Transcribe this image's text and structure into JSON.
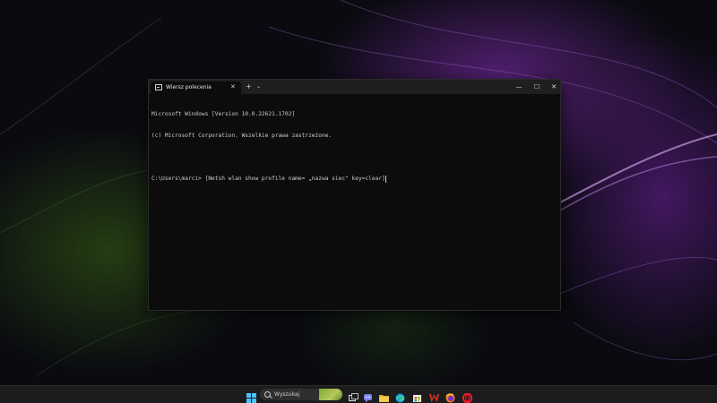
{
  "terminal": {
    "tab_title": "Wiersz polecenia",
    "tab_close": "✕",
    "new_tab": "+",
    "tab_dropdown": "⌄",
    "minimize": "—",
    "maximize": "☐",
    "close": "✕",
    "lines": [
      "Microsoft Windows [Version 10.0.22621.1702]",
      "(c) Microsoft Corporation. Wszelkie prawa zastrzeżone.",
      "",
      "C:\\Users\\marci> [Netsh wlan show profile name= „nazwa siec\" key=clear]"
    ]
  },
  "taskbar": {
    "search_placeholder": "Wyszukaj",
    "icons": [
      "windows-start-icon",
      "search-icon",
      "task-view-icon",
      "teams-chat-icon",
      "file-explorer-icon",
      "edge-icon",
      "store-icon",
      "office-w-icon",
      "firefox-icon",
      "opera-icon"
    ]
  },
  "colors": {
    "terminal_bg": "#0c0c0c",
    "titlebar_bg": "#1f1f1f",
    "text": "#cccccc",
    "taskbar_bg": "#1c1c1c",
    "wallpaper_purple": "#8a3fc0",
    "wallpaper_green": "#3d6a1c"
  }
}
